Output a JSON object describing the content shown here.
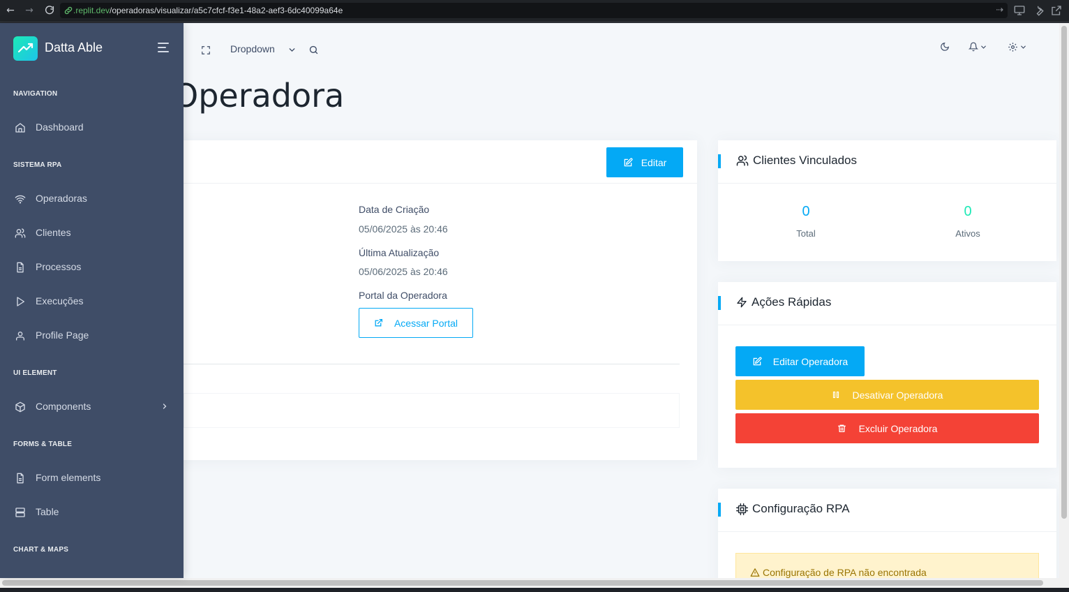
{
  "browser": {
    "url_host": ".replit.dev",
    "url_path": "/operadoras/visualizar/a5c7cfcf-f3e1-48a2-aef3-6dc40099a64e"
  },
  "sidebar": {
    "brand": "Datta Able",
    "sections": [
      {
        "caption": "NAVIGATION",
        "items": [
          {
            "label": "Dashboard",
            "icon": "home-icon"
          }
        ]
      },
      {
        "caption": "SISTEMA RPA",
        "items": [
          {
            "label": "Operadoras",
            "icon": "wifi-icon"
          },
          {
            "label": "Clientes",
            "icon": "users-icon"
          },
          {
            "label": "Processos",
            "icon": "file-text-icon"
          },
          {
            "label": "Execuções",
            "icon": "play-icon"
          },
          {
            "label": "Profile Page",
            "icon": "user-icon"
          }
        ]
      },
      {
        "caption": "UI ELEMENT",
        "items": [
          {
            "label": "Components",
            "icon": "box-icon",
            "has_submenu": true
          }
        ]
      },
      {
        "caption": "FORMS & TABLE",
        "items": [
          {
            "label": "Form elements",
            "icon": "file-text-icon"
          },
          {
            "label": "Table",
            "icon": "server-icon"
          }
        ]
      },
      {
        "caption": "CHART & MAPS",
        "items": []
      }
    ]
  },
  "header": {
    "dropdown_label": "Dropdown"
  },
  "main": {
    "page_title": "Operadora",
    "details_card": {
      "edit_label": "Editar",
      "created_label": "Data de Criação",
      "created_value": "05/06/2025 às 20:46",
      "updated_label": "Última Atualização",
      "updated_value": "05/06/2025 às 20:46",
      "portal_label": "Portal da Operadora",
      "portal_button": "Acessar Portal"
    },
    "clients_card": {
      "title": "Clientes Vinculados",
      "total_value": "0",
      "total_label": "Total",
      "active_value": "0",
      "active_label": "Ativos"
    },
    "actions_card": {
      "title": "Ações Rápidas",
      "edit_button": "Editar Operadora",
      "deactivate_button": "Desativar Operadora",
      "delete_button": "Excluir Operadora"
    },
    "rpa_card": {
      "title": "Configuração RPA",
      "alert_text": "Configuração de RPA não encontrada"
    }
  },
  "colors": {
    "sidebar_bg": "#3f4d67",
    "primary": "#04a9f5",
    "success_teal": "#1de9b6",
    "warning": "#f4c22b",
    "danger": "#f44236",
    "page_bg": "#f4f7fa"
  }
}
